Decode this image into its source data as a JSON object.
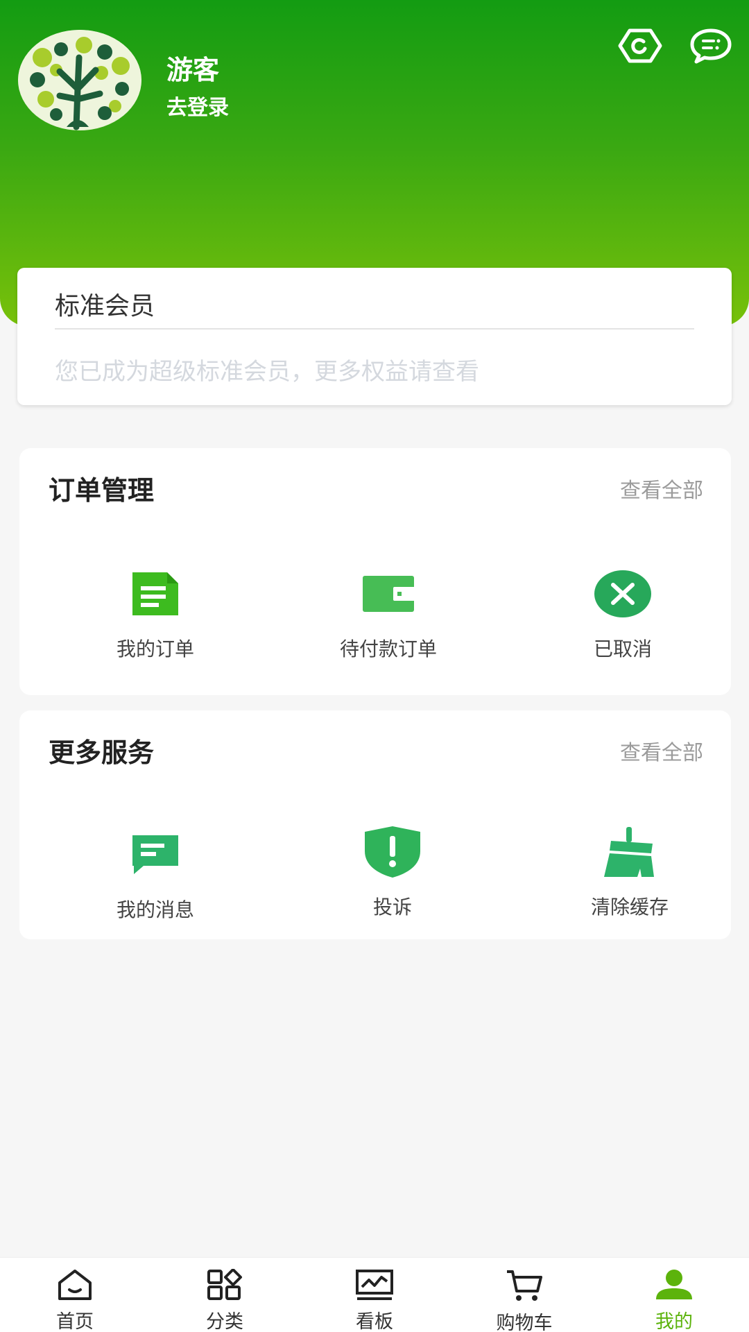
{
  "header": {
    "user_name": "游客",
    "login_link": "去登录"
  },
  "member": {
    "title": "标准会员",
    "description": "您已成为超级标准会员，更多权益请查看"
  },
  "orders": {
    "title": "订单管理",
    "view_all": "查看全部",
    "items": [
      {
        "label": "我的订单",
        "icon": "document-icon"
      },
      {
        "label": "待付款订单",
        "icon": "wallet-icon"
      },
      {
        "label": "已取消",
        "icon": "cancel-circle-icon"
      }
    ]
  },
  "services": {
    "title": "更多服务",
    "view_all": "查看全部",
    "items": [
      {
        "label": "我的消息",
        "icon": "message-icon"
      },
      {
        "label": "投诉",
        "icon": "shield-alert-icon"
      },
      {
        "label": "清除缓存",
        "icon": "broom-icon"
      }
    ]
  },
  "tabbar": {
    "items": [
      {
        "label": "首页",
        "icon": "home-icon"
      },
      {
        "label": "分类",
        "icon": "category-icon"
      },
      {
        "label": "看板",
        "icon": "dashboard-icon"
      },
      {
        "label": "购物车",
        "icon": "cart-icon"
      },
      {
        "label": "我的",
        "icon": "user-icon",
        "active": true
      }
    ]
  },
  "colors": {
    "header_top": "#139c12",
    "header_bottom": "#78c10a",
    "accent": "#5cb30c",
    "order_icon": "#3dbb1f",
    "service_icon": "#2db36a"
  }
}
